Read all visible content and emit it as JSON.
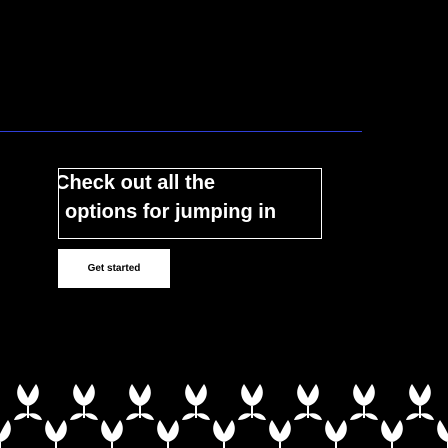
{
  "hero": {
    "headline_line1": "Check out all the",
    "headline_line2": "options for jumping in",
    "cta_label": "Get started"
  },
  "colors": {
    "background": "#000000",
    "accent_rule": "#2f3fd9",
    "text": "#ffffff",
    "button_bg": "#ffffff",
    "button_text": "#000000",
    "pattern": "#ffffff"
  },
  "decor": {
    "pattern_icon": "tulip-pattern-icon"
  }
}
